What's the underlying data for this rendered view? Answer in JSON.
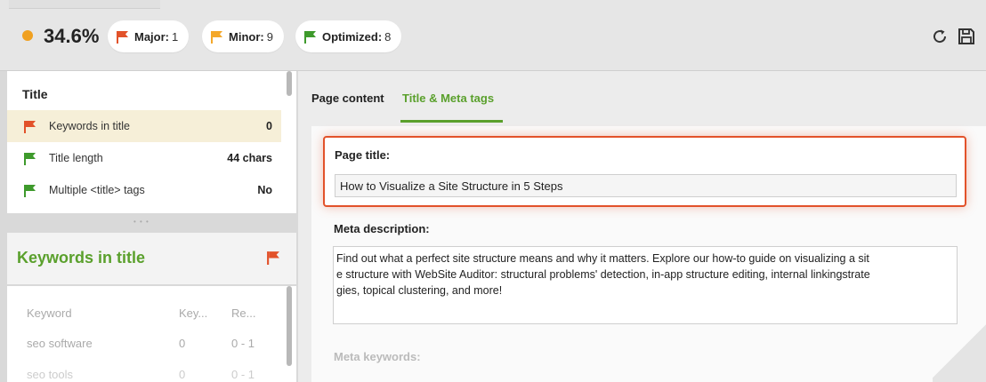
{
  "colors": {
    "accent_green": "#5aa02c",
    "score_orange": "#f0a020",
    "major_red": "#e2522a",
    "minor_orange": "#f4a82a",
    "optimized_green": "#3e9a2c",
    "highlight_border": "#e2522a"
  },
  "toolbar": {
    "score": "34.6%",
    "badges": [
      {
        "label": "Major:",
        "count": "1",
        "icon": "red-flag-icon"
      },
      {
        "label": "Minor:",
        "count": "9",
        "icon": "orange-flag-icon"
      },
      {
        "label": "Optimized:",
        "count": "8",
        "icon": "green-flag-icon"
      }
    ],
    "icons": [
      "refresh-icon",
      "save-icon"
    ]
  },
  "factors": {
    "section_title": "Title",
    "rows": [
      {
        "label": "Keywords in title",
        "value": "0",
        "status": "major"
      },
      {
        "label": "Title length",
        "value": "44 chars",
        "status": "optimized"
      },
      {
        "label": "Multiple <title> tags",
        "value": "No",
        "status": "optimized"
      }
    ]
  },
  "details": {
    "title": "Keywords in title",
    "flag_icon": "red-flag-icon",
    "columns": [
      "Keyword",
      "Key...",
      "Re..."
    ],
    "rows": [
      [
        "seo software",
        "0",
        "0 - 1"
      ],
      [
        "seo tools",
        "0",
        "0 - 1"
      ]
    ]
  },
  "tabs": [
    {
      "label": "Page content",
      "active": false
    },
    {
      "label": "Title & Meta tags",
      "active": true
    }
  ],
  "fields": {
    "page_title_label": "Page title:",
    "page_title_value": "How to Visualize a Site Structure in 5 Steps",
    "meta_description_label": "Meta description:",
    "meta_description_line1": "Find out what a perfect site structure means and why it matters. Explore our how-to guide on visualizing a sit",
    "meta_description_line2": "e structure with WebSite Auditor: structural problems' detection, in-app structure editing, internal linkingstrate",
    "meta_description_line3": "gies, topical clustering, and more!",
    "meta_keywords_label": "Meta keywords:"
  }
}
